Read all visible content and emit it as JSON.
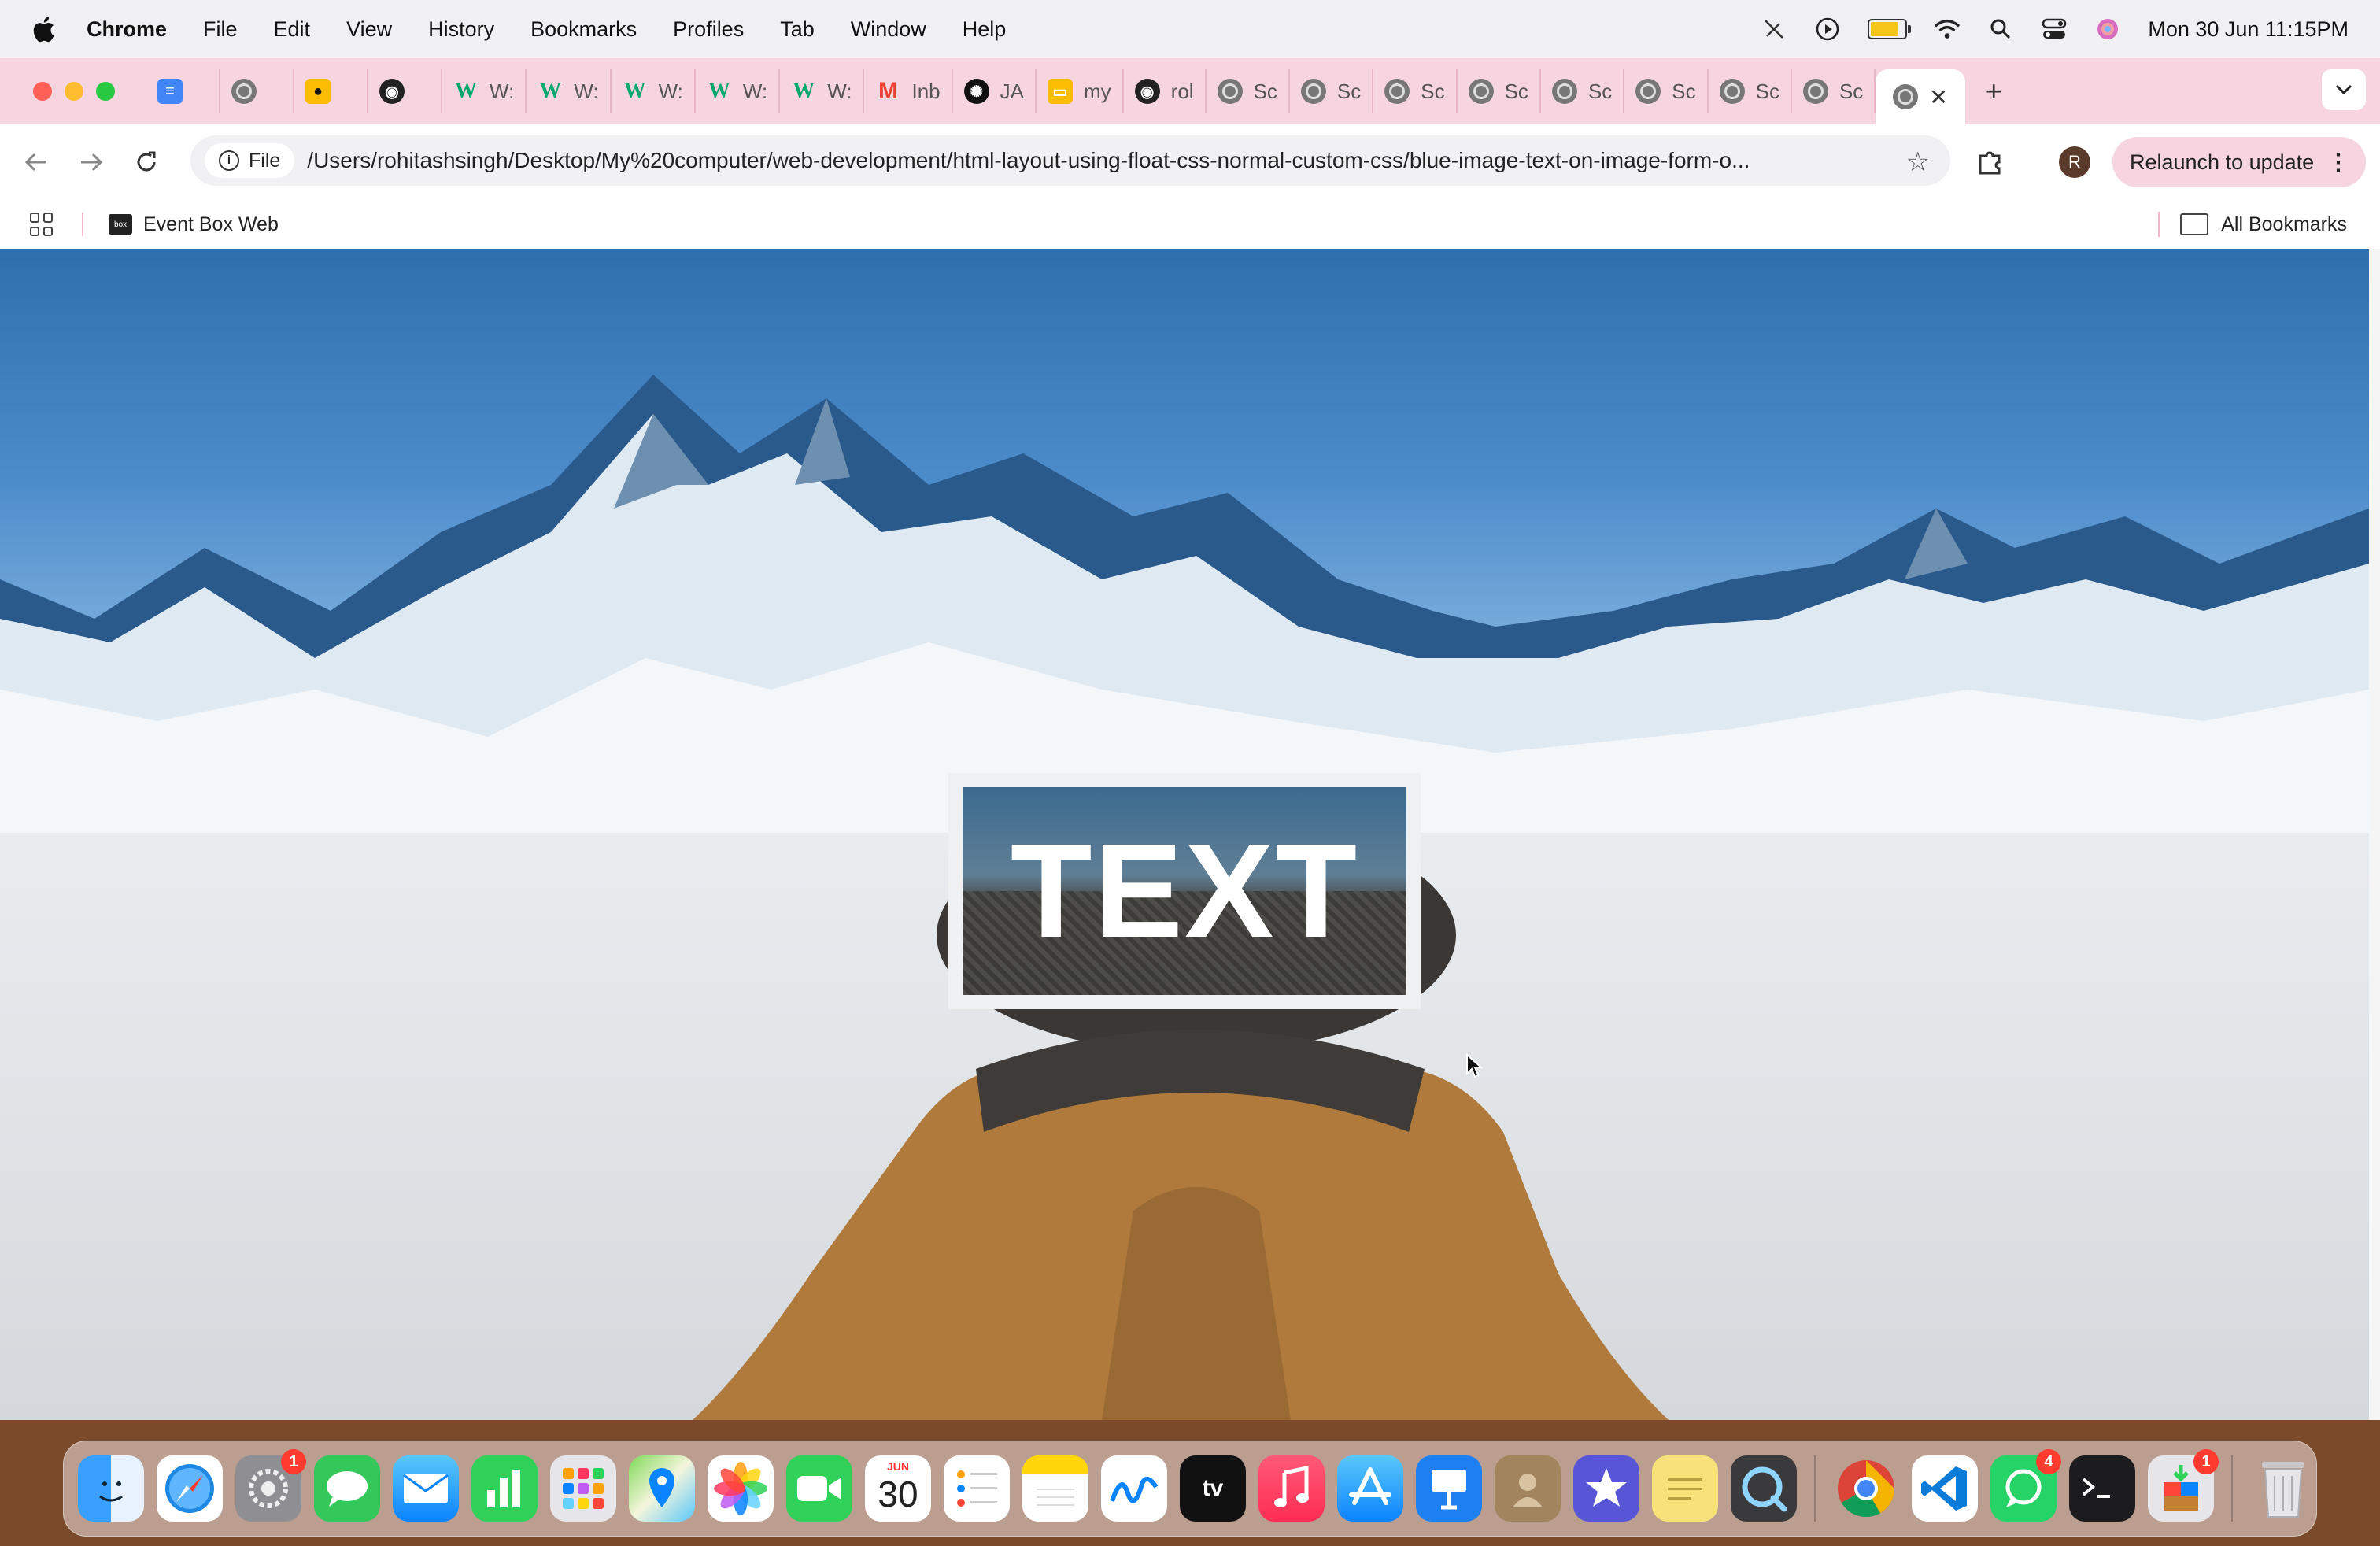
{
  "menubar": {
    "app_name": "Chrome",
    "menus": [
      "File",
      "Edit",
      "View",
      "History",
      "Bookmarks",
      "Profiles",
      "Tab",
      "Window",
      "Help"
    ],
    "clock": "Mon 30 Jun  11:15PM",
    "battery_level": 0.75
  },
  "tabs": [
    {
      "icon": "docs-icon",
      "label": ""
    },
    {
      "icon": "globe-icon",
      "label": ""
    },
    {
      "icon": "yellow-app-icon",
      "label": ""
    },
    {
      "icon": "github-icon",
      "label": ""
    },
    {
      "icon": "w3schools-icon",
      "label": "W:"
    },
    {
      "icon": "w3schools-icon",
      "label": "W:"
    },
    {
      "icon": "w3schools-icon",
      "label": "W:"
    },
    {
      "icon": "w3schools-icon",
      "label": "W:"
    },
    {
      "icon": "w3schools-icon",
      "label": "W:"
    },
    {
      "icon": "gmail-icon",
      "label": "Inb"
    },
    {
      "icon": "chatgpt-icon",
      "label": "JA"
    },
    {
      "icon": "slides-icon",
      "label": "my"
    },
    {
      "icon": "github-icon",
      "label": "rol"
    },
    {
      "icon": "globe-icon",
      "label": "Sc"
    },
    {
      "icon": "globe-icon",
      "label": "Sc"
    },
    {
      "icon": "globe-icon",
      "label": "Sc"
    },
    {
      "icon": "globe-icon",
      "label": "Sc"
    },
    {
      "icon": "globe-icon",
      "label": "Sc"
    },
    {
      "icon": "globe-icon",
      "label": "Sc"
    },
    {
      "icon": "globe-icon",
      "label": "Sc"
    },
    {
      "icon": "globe-icon",
      "label": "Sc"
    }
  ],
  "toolbar": {
    "chip_label": "File",
    "url": "/Users/rohitashsingh/Desktop/My%20computer/web-development/html-layout-using-float-css-normal-custom-css/blue-image-text-on-image-form-o...",
    "avatar_initial": "R",
    "relaunch_label": "Relaunch to update"
  },
  "bookmarks": {
    "items": [
      {
        "label": "Event Box Web"
      }
    ],
    "all_label": "All Bookmarks"
  },
  "page": {
    "overlay_text": "TEXT"
  },
  "dock": {
    "calendar_month": "JUN",
    "calendar_day": "30",
    "badges": {
      "settings": "1",
      "whatsapp": "4",
      "installer": "1"
    }
  }
}
